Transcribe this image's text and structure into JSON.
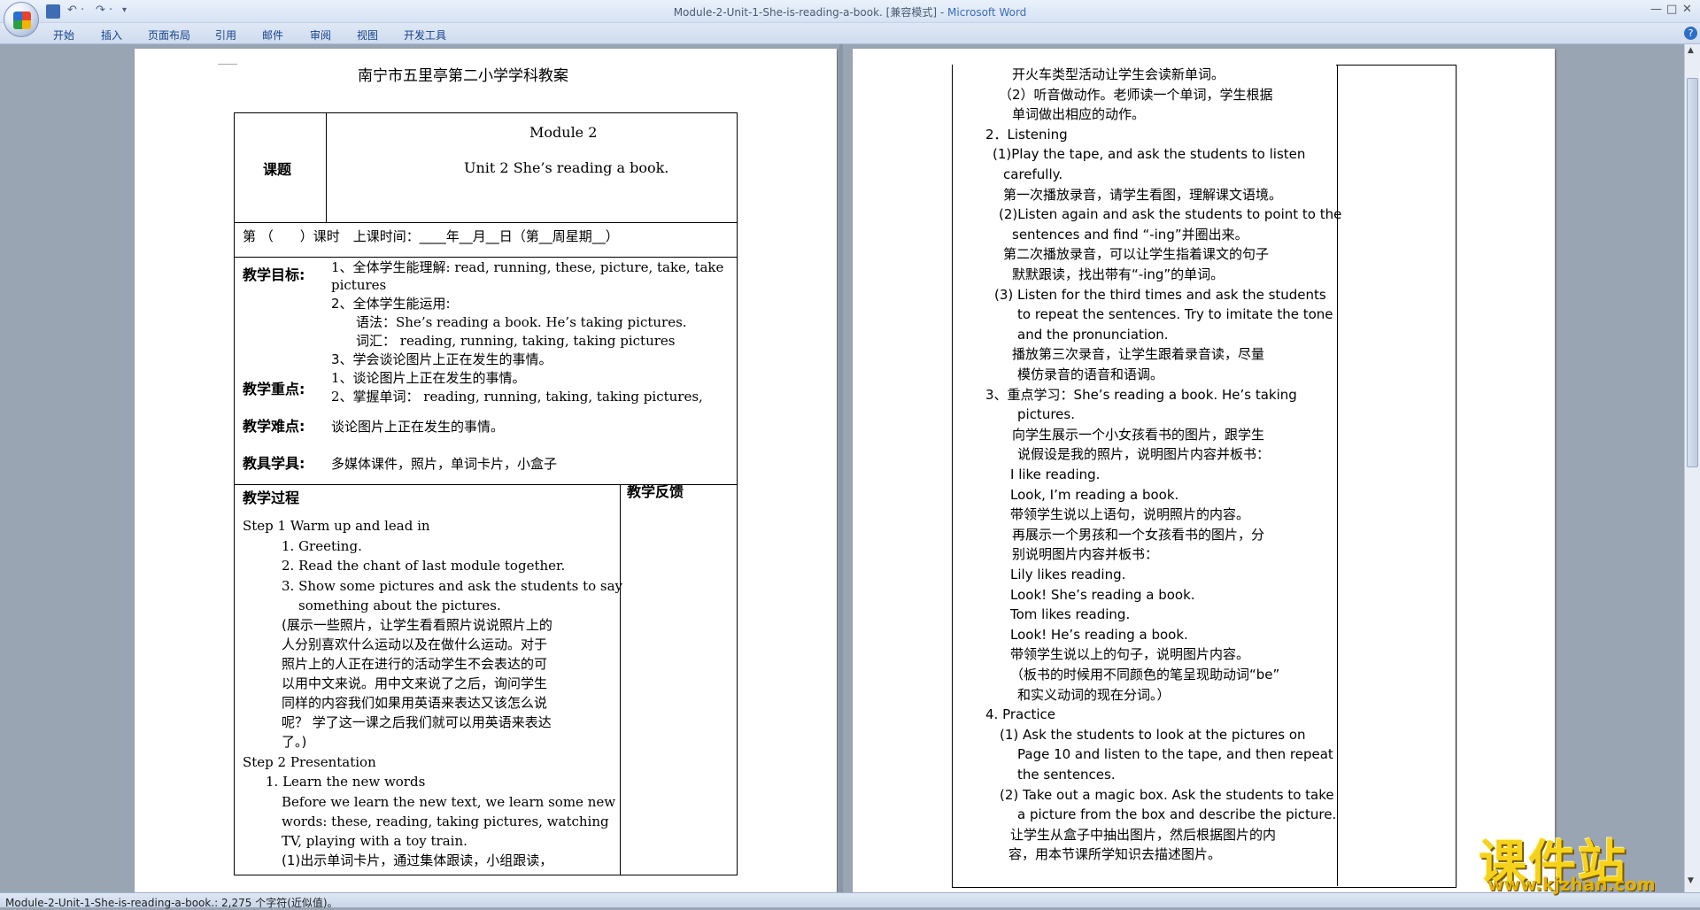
{
  "window": {
    "title": "Module-2-Unit-1-She-is-reading-a-book. [兼容模式] - ",
    "app": "Microsoft Word",
    "min": "—",
    "max": "□",
    "close": "✕"
  },
  "qat": {
    "undo": "↶ ·",
    "redo": "↷ ·",
    "more": "▾"
  },
  "ribbon": {
    "tabs": [
      "开始",
      "插入",
      "页面布局",
      "引用",
      "邮件",
      "审阅",
      "视图",
      "开发工具"
    ]
  },
  "help": "?",
  "status": {
    "text": "Module-2-Unit-1-She-is-reading-a-book.: 2,275 个字符(近似值)。"
  },
  "watermark": {
    "main": "课件站",
    "url": "www.kjzhan.com"
  },
  "page1": {
    "title": "南宁市五里亭第二小学学科教案",
    "topic_label": "课题",
    "module": "Module 2",
    "unit": "Unit 2 She’s reading a book.",
    "lesson_time": "第 （　　）课时　上课时间：____年__月__日（第__周星期__）",
    "goal_label": "教学目标:",
    "goals": [
      "1、全体学生能理解: read, running, these, picture, take, take",
      "pictures",
      "2、全体学生能运用:",
      "语法：She’s reading a book. He’s taking pictures.",
      "词汇：  reading, running, taking, taking pictures",
      "3、学会谈论图片上正在发生的事情。"
    ],
    "key_label": "教学重点:",
    "keys": [
      "1、谈论图片上正在发生的事情。",
      "2、掌握单词：  reading, running, taking, taking pictures,"
    ],
    "diff_label": "教学难点:",
    "diff": "谈论图片上正在发生的事情。",
    "tools_label": "教具学具:",
    "tools": "多媒体课件，照片，单词卡片，小盒子",
    "process_label": "教学过程",
    "feedback_label": "教学反馈",
    "process": [
      "Step 1 Warm up and lead in",
      "1. Greeting.",
      "2. Read the chant of last module together.",
      "3. Show some pictures and ask the students to say",
      "something about the pictures.",
      "(展示一些照片，让学生看看照片说说照片上的",
      "人分别喜欢什么运动以及在做什么运动。对于",
      "照片上的人正在进行的活动学生不会表达的可",
      "以用中文来说。用中文来说了之后，询问学生",
      "同样的内容我们如果用英语来表达又该怎么说",
      "呢？ 学了这一课之后我们就可以用英语来表达",
      "了。)",
      "Step 2 Presentation",
      "1. Learn the new words",
      "Before we learn the new text, we learn some new",
      "words: these, reading, taking pictures, watching",
      "TV, playing with a toy train.",
      "(1)出示单词卡片，通过集体跟读，小组跟读，"
    ]
  },
  "page2": {
    "lines": [
      "开火车类型活动让学生会读新单词。",
      "（2）听音做动作。老师读一个单词，学生根据",
      "单词做出相应的动作。",
      "2．Listening",
      "(1)Play the tape, and ask the students to listen",
      "carefully.",
      "第一次播放录音，请学生看图，理解课文语境。",
      "(2)Listen again and ask the students to point to the",
      "sentences and find “-ing”并圈出来。",
      "第二次播放录音，可以让学生指着课文的句子",
      "默默跟读，找出带有“-ing”的单词。",
      "(3) Listen for the third times and ask the students",
      "to repeat the sentences. Try to imitate the tone",
      "and the pronunciation.",
      "播放第三次录音，让学生跟着录音读，尽量",
      "模仿录音的语音和语调。",
      "3、重点学习：She’s reading a book. He’s taking",
      "pictures.",
      "向学生展示一个小女孩看书的图片，跟学生",
      "说假设是我的照片，说明图片内容并板书：",
      "I like reading.",
      "Look, I’m reading a book.",
      "带领学生说以上语句，说明照片的内容。",
      "再展示一个男孩和一个女孩看书的图片，分",
      "别说明图片内容并板书：",
      "Lily likes reading.",
      "Look! She’s reading a book.",
      "Tom likes reading.",
      "Look! He’s reading a book.",
      "带领学生说以上的句子，说明图片内容。",
      "（板书的时候用不同颜色的笔呈现助动词“be”",
      "和实义动词的现在分词。）",
      "4. Practice",
      "(1) Ask the students to look at the pictures on",
      "Page 10 and listen to the tape, and then repeat",
      "the sentences.",
      "(2) Take out a magic box. Ask the students to take",
      "a picture from the box and describe the picture.",
      "让学生从盒子中抽出图片，然后根据图片的内",
      "容，用本节课所学知识去描述图片。"
    ]
  }
}
